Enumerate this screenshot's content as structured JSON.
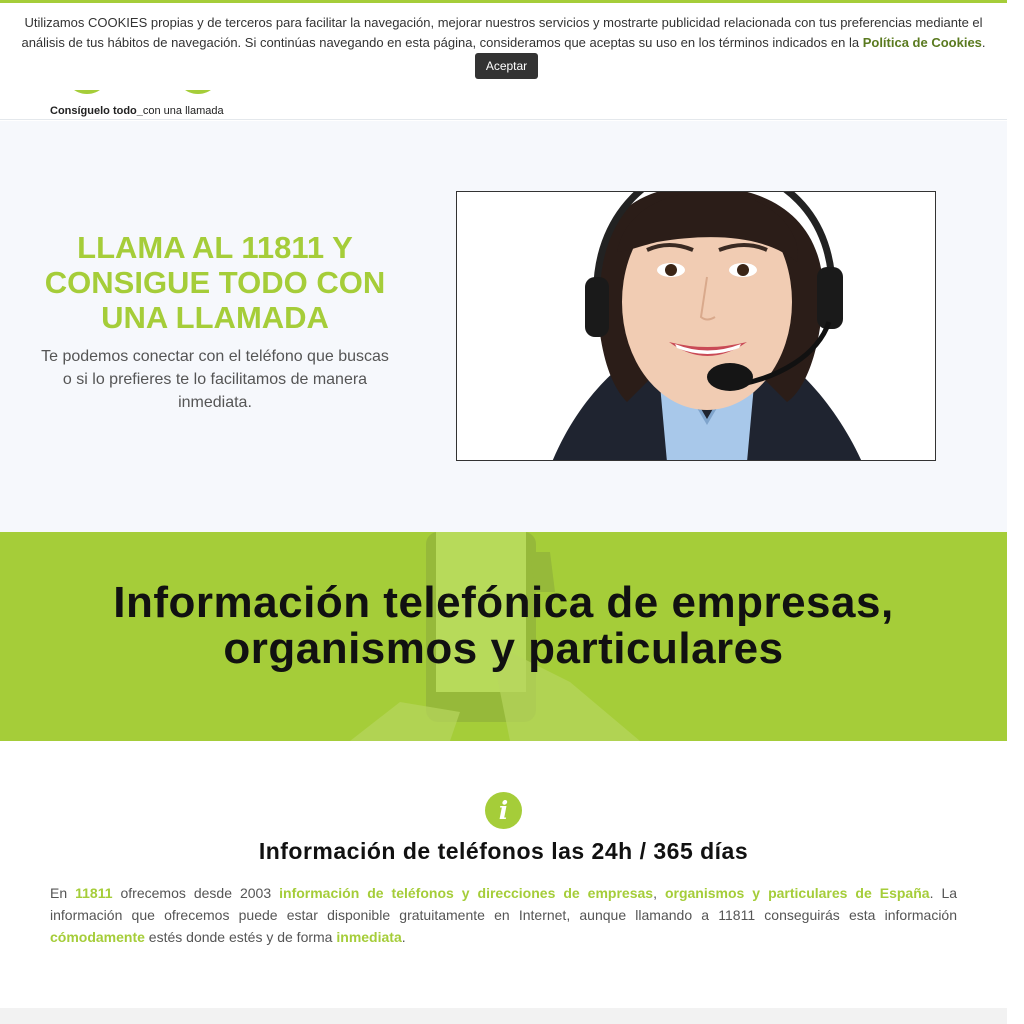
{
  "header": {
    "tagline_bold": "Consíguelo todo_",
    "tagline_rest": "con una llamada"
  },
  "cookie_banner": {
    "text": "Utilizamos COOKIES propias y de terceros para facilitar la navegación, mejorar nuestros servicios y mostrarte publicidad relacionada con tus preferencias mediante el análisis de tus hábitos de navegación. Si continúas navegando en esta página, consideramos que aceptas su uso en los términos indicados en la",
    "link_label": "Política de Cookies",
    "link_suffix": ".",
    "accept_label": "Aceptar"
  },
  "hero": {
    "title": "LLAMA AL 11811 Y CONSIGUE TODO CON UNA LLAMADA",
    "description": "Te podemos conectar con el teléfono que buscas o si lo prefieres te lo facilitamos de manera inmediata."
  },
  "band": {
    "title_line1": "Información telefónica de empresas,",
    "title_line2": "organismos y particulares"
  },
  "info": {
    "icon_glyph": "i",
    "icon_name": "info-icon",
    "heading": "Información de teléfonos las 24h / 365 días",
    "p_1": "En ",
    "p_2": "11811",
    "p_3": " ofrecemos desde 2003 ",
    "p_4": "información de teléfonos y direcciones de empresas",
    "p_5": ", ",
    "p_6": "organismos y particulares de España",
    "p_7": ". La información que ofrecemos puede estar disponible gratuitamente en Internet, aunque llamando a 11811 conseguirás esta información ",
    "p_8": "cómodamente",
    "p_9": " estés donde estés y de forma ",
    "p_10": "inmediata",
    "p_11": "."
  },
  "colors": {
    "accent": "#a5cd39",
    "cookie_link": "#5a7a1f",
    "button_bg": "#333333",
    "hero_bg": "#f6f8fc"
  }
}
